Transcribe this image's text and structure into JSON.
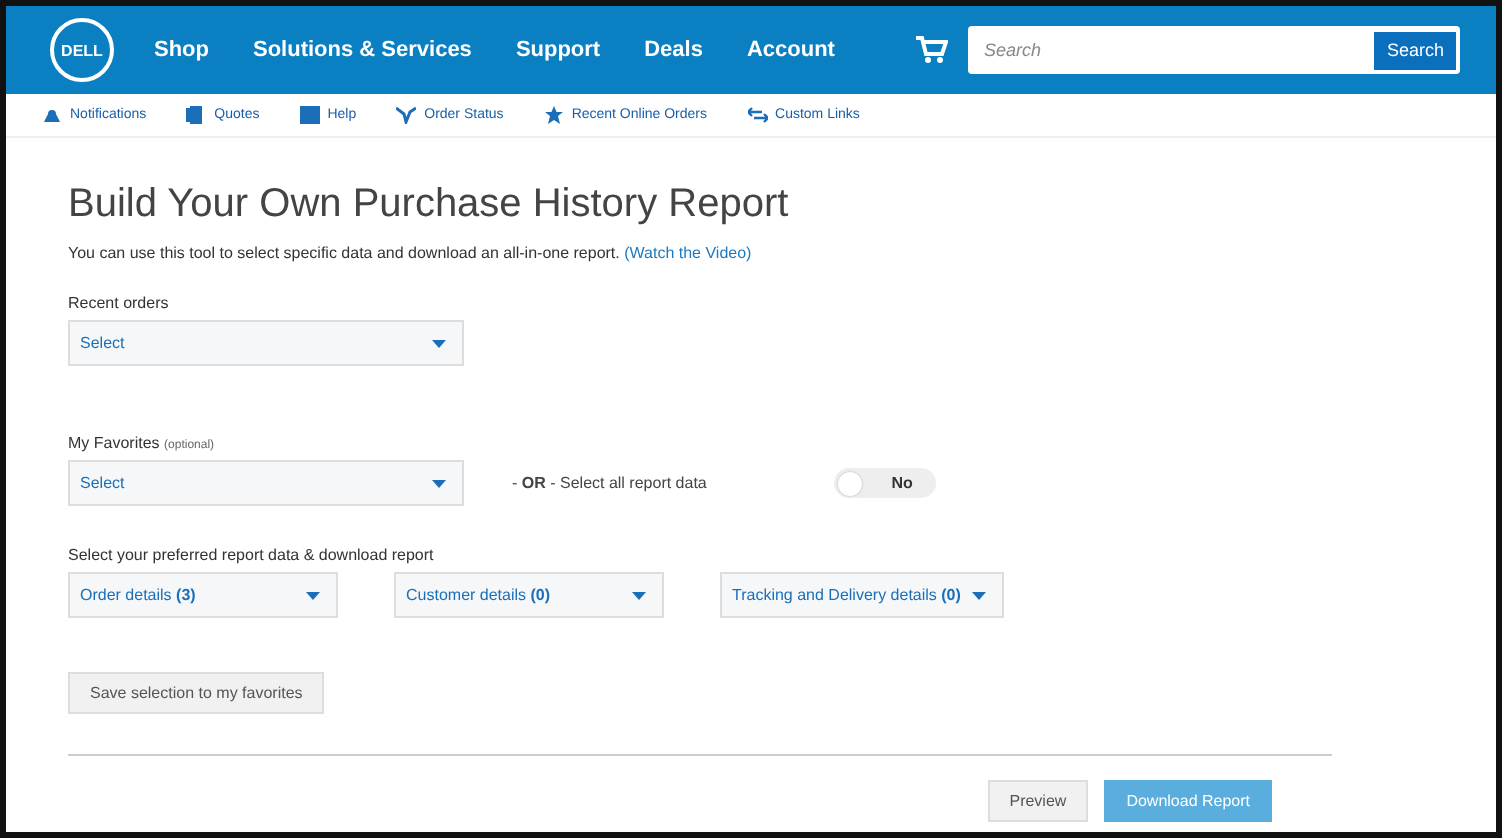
{
  "header": {
    "logo": "DELL",
    "nav": [
      "Shop",
      "Solutions & Services",
      "Support",
      "Deals",
      "Account"
    ],
    "search": {
      "placeholder": "Search",
      "button": "Search"
    }
  },
  "subnav": [
    "Notifications",
    "Quotes",
    "Help",
    "Order Status",
    "Recent Online Orders",
    "Custom Links"
  ],
  "title": "Build Your Own Purchase History Report",
  "intro": {
    "text": "You can use this tool to select specific data and download an all-in-one report.",
    "link": "(Watch the Video)"
  },
  "recent_orders": {
    "label": "Recent orders",
    "value": "Select"
  },
  "favorites": {
    "label": "My Favorites",
    "hint": "(optional)",
    "value": "Select",
    "or_text": "- **OR** - Select all report data",
    "toggle": {
      "on": false,
      "label": "No"
    }
  },
  "report_data": {
    "label": "Select your preferred report data & download report",
    "dropdowns": [
      "Order details **(3)**",
      "Customer details **(0)**",
      "Tracking and Delivery details **(0)**"
    ]
  },
  "save_button": "Save selection to my favorites",
  "buttons": [
    {
      "label": "Preview",
      "kind": "secondary"
    },
    {
      "label": "Download Report",
      "kind": "primary"
    }
  ]
}
